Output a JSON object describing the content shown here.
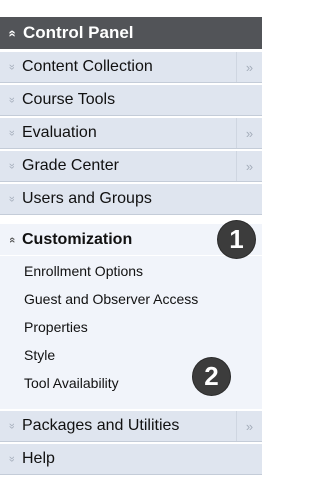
{
  "panel": {
    "title": "Control Panel",
    "title_chevron": "«",
    "items": [
      {
        "label": "Content Collection",
        "chevron": "«",
        "context": "»"
      },
      {
        "label": "Course Tools",
        "chevron": "«",
        "context": ""
      },
      {
        "label": "Evaluation",
        "chevron": "«",
        "context": "»"
      },
      {
        "label": "Grade Center",
        "chevron": "«",
        "context": "»"
      },
      {
        "label": "Users and Groups",
        "chevron": "«",
        "context": ""
      },
      {
        "label": "Customization",
        "chevron": "«",
        "context": "»",
        "expanded": true
      },
      {
        "label": "Packages and Utilities",
        "chevron": "«",
        "context": "»"
      },
      {
        "label": "Help",
        "chevron": "«",
        "context": ""
      }
    ],
    "customization_subitems": [
      "Enrollment Options",
      "Guest and Observer Access",
      "Properties",
      "Style",
      "Tool Availability"
    ]
  },
  "callouts": [
    "1",
    "2"
  ],
  "colors": {
    "header_bg": "#525458",
    "row_bg": "#dfe5ef",
    "active_bg": "#f1f4fa",
    "badge_bg": "#3c3c3c"
  },
  "icons": {
    "collapse": "chevron-double-up-icon",
    "context": "chevron-double-right-icon"
  }
}
